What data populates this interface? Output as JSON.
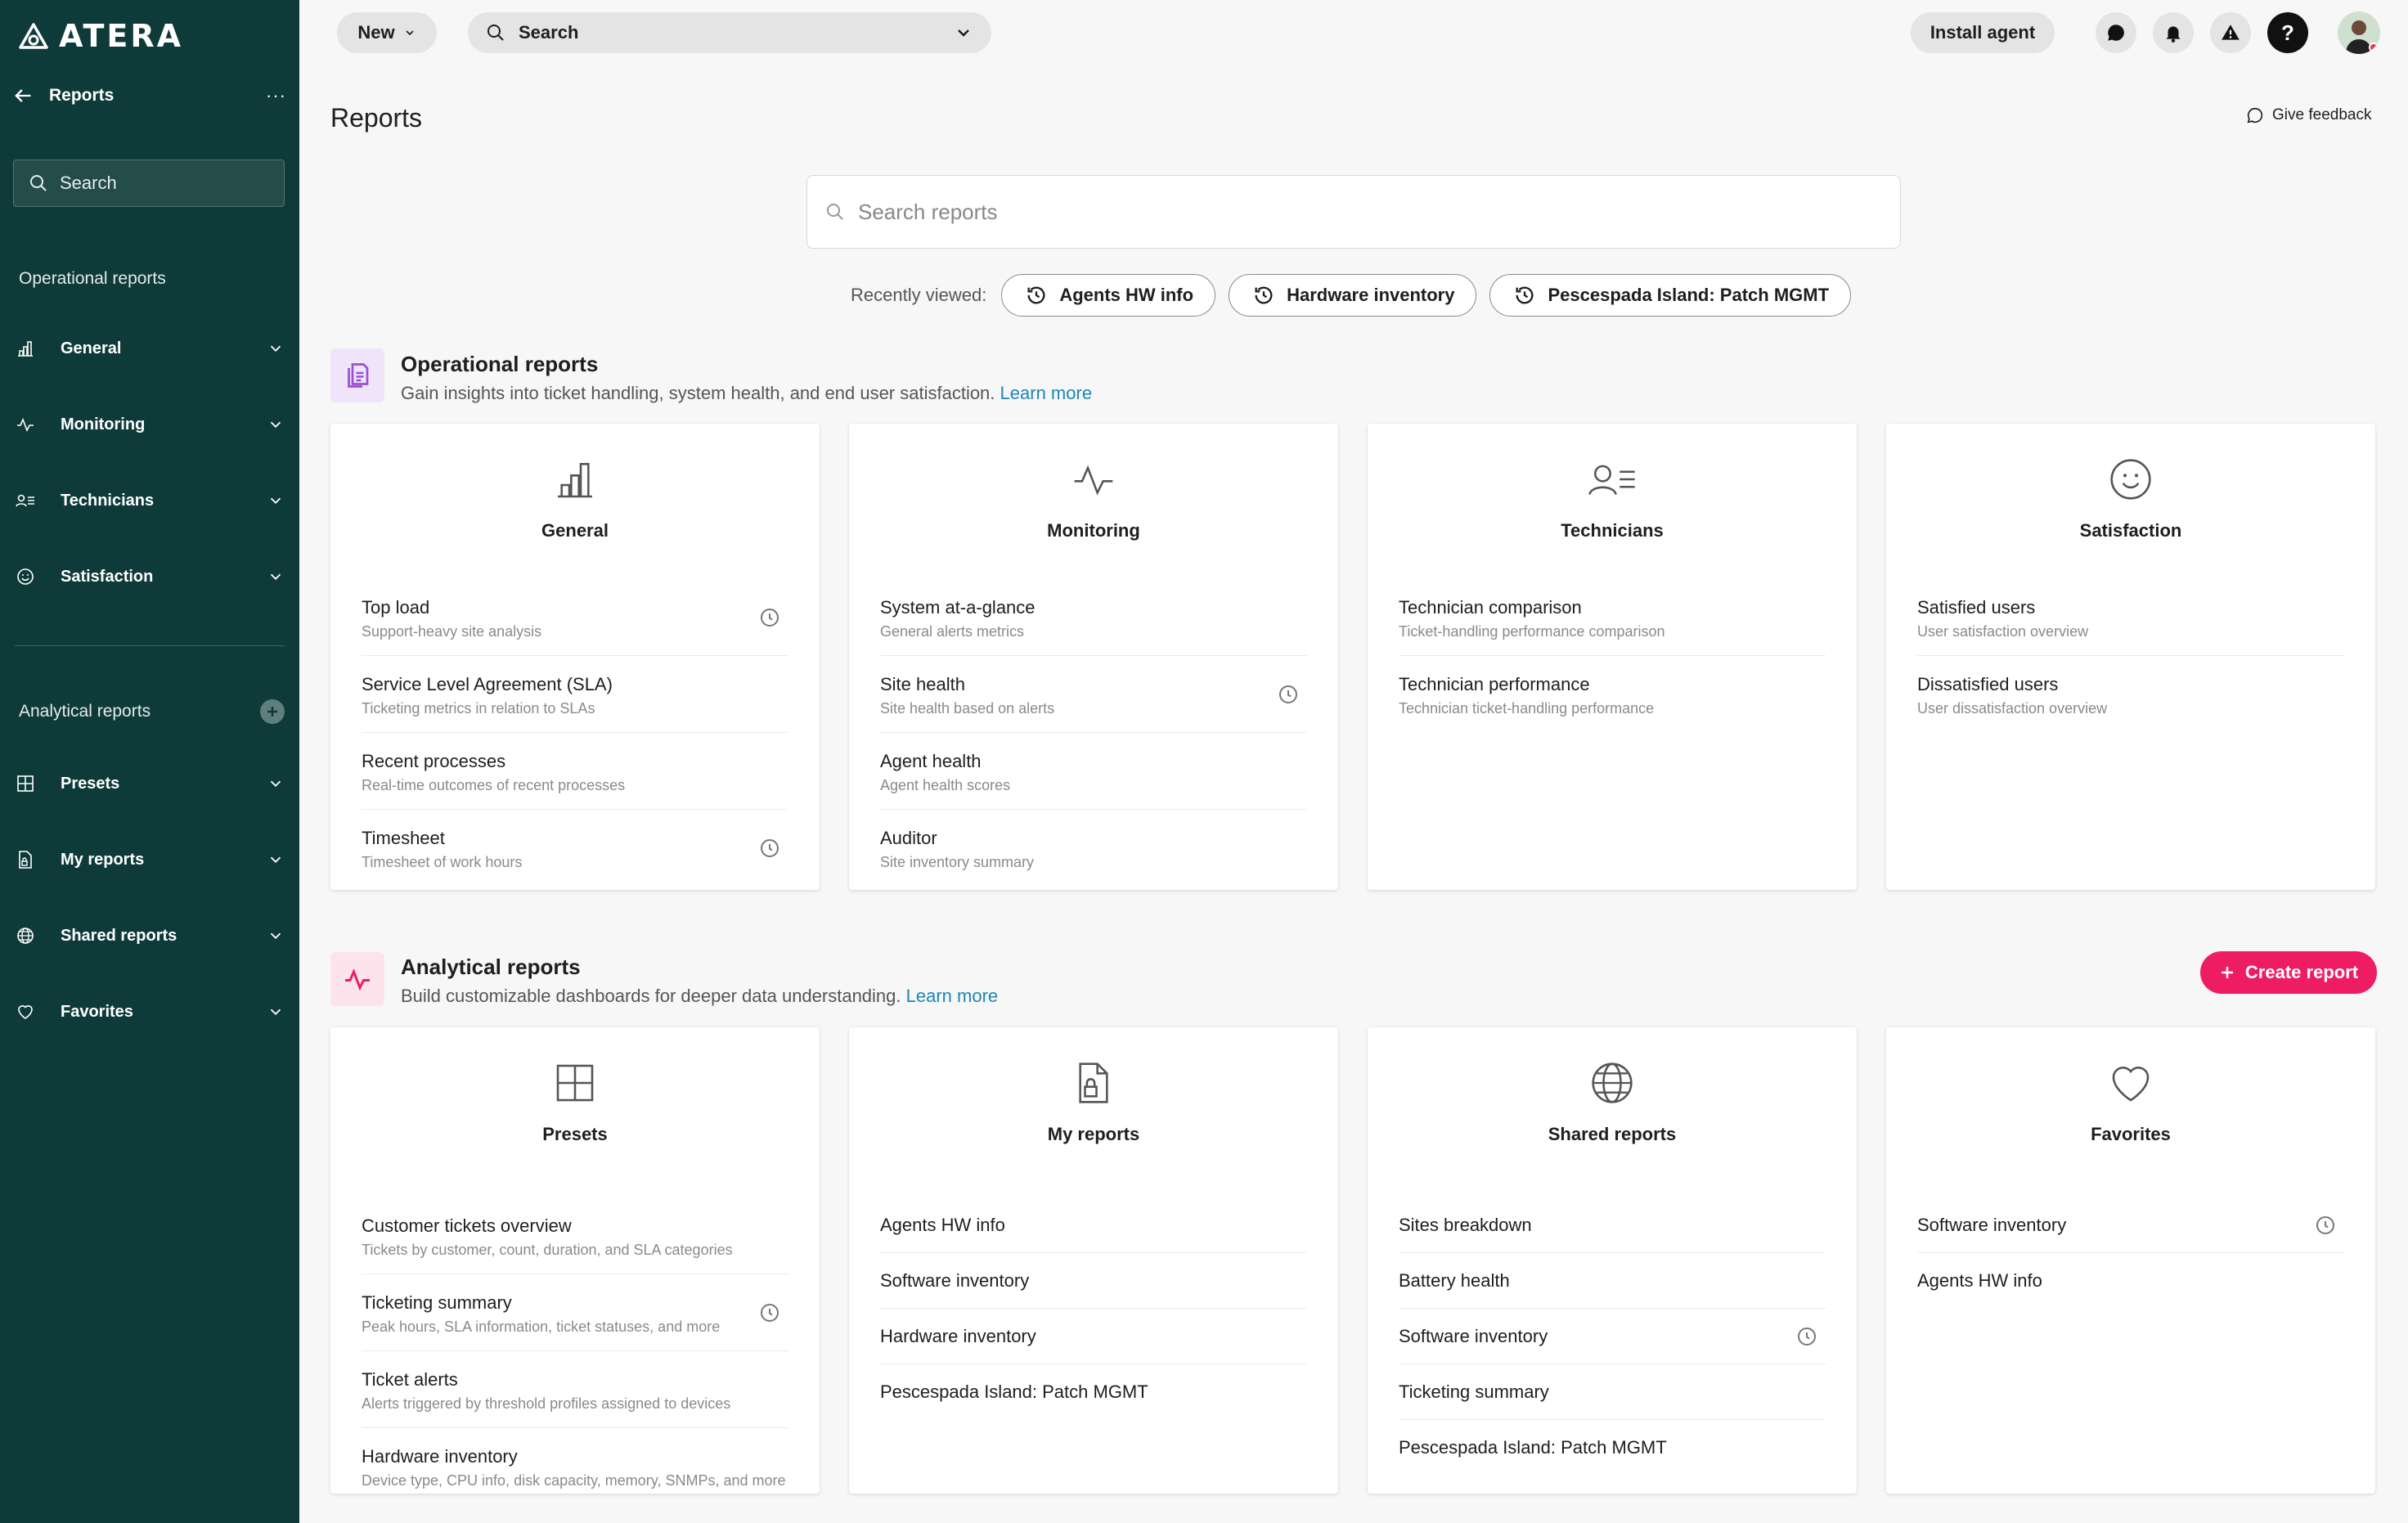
{
  "brand": {
    "logo_text": "ATERA"
  },
  "sidebar": {
    "header_title": "Reports",
    "more_label": "···",
    "search_placeholder": "Search",
    "operational_heading": "Operational reports",
    "operational_items": [
      {
        "label": "General",
        "icon": "bar-chart-icon"
      },
      {
        "label": "Monitoring",
        "icon": "pulse-icon"
      },
      {
        "label": "Technicians",
        "icon": "technician-list-icon"
      },
      {
        "label": "Satisfaction",
        "icon": "smiley-icon"
      }
    ],
    "analytical_heading": "Analytical reports",
    "analytical_items": [
      {
        "label": "Presets",
        "icon": "grid-icon"
      },
      {
        "label": "My reports",
        "icon": "file-lock-icon"
      },
      {
        "label": "Shared reports",
        "icon": "globe-icon"
      },
      {
        "label": "Favorites",
        "icon": "heart-icon"
      }
    ]
  },
  "topbar": {
    "new_label": "New",
    "search_label": "Search",
    "install_label": "Install agent",
    "icons": [
      "chat-icon",
      "bell-icon",
      "alert-icon",
      "help-icon",
      "avatar"
    ]
  },
  "page": {
    "title": "Reports",
    "feedback_label": "Give feedback",
    "search_placeholder": "Search reports",
    "recent_label": "Recently viewed:",
    "recent_chips": [
      "Agents HW info",
      "Hardware inventory",
      "Pescespada Island: Patch MGMT"
    ]
  },
  "operational": {
    "title": "Operational reports",
    "desc": "Gain insights into ticket handling, system health, and end user satisfaction.",
    "learn_more": "Learn more",
    "icon_color": "#9b4fd1",
    "cards": [
      {
        "title": "General",
        "icon": "bar-chart-icon",
        "items": [
          {
            "title": "Top load",
            "sub": "Support-heavy site analysis",
            "recent": true
          },
          {
            "title": "Service Level Agreement (SLA)",
            "sub": "Ticketing metrics in relation to SLAs",
            "recent": false
          },
          {
            "title": "Recent processes",
            "sub": "Real-time outcomes of recent processes",
            "recent": false
          },
          {
            "title": "Timesheet",
            "sub": "Timesheet of work hours",
            "recent": true
          }
        ]
      },
      {
        "title": "Monitoring",
        "icon": "pulse-icon",
        "items": [
          {
            "title": "System at-a-glance",
            "sub": "General alerts metrics",
            "recent": false
          },
          {
            "title": "Site health",
            "sub": "Site health based on alerts",
            "recent": true
          },
          {
            "title": "Agent health",
            "sub": "Agent health scores",
            "recent": false
          },
          {
            "title": "Auditor",
            "sub": "Site inventory summary",
            "recent": false
          }
        ]
      },
      {
        "title": "Technicians",
        "icon": "technician-list-icon",
        "items": [
          {
            "title": "Technician comparison",
            "sub": "Ticket-handling performance comparison",
            "recent": false
          },
          {
            "title": "Technician performance",
            "sub": "Technician ticket-handling performance",
            "recent": false
          }
        ]
      },
      {
        "title": "Satisfaction",
        "icon": "smiley-icon",
        "items": [
          {
            "title": "Satisfied users",
            "sub": "User satisfaction overview",
            "recent": false
          },
          {
            "title": "Dissatisfied users",
            "sub": "User dissatisfaction overview",
            "recent": false
          }
        ]
      }
    ]
  },
  "analytical": {
    "title": "Analytical reports",
    "desc": "Build customizable dashboards for deeper data understanding.",
    "learn_more": "Learn more",
    "create_label": "Create report",
    "icon_color": "#ee1d63",
    "cards": [
      {
        "title": "Presets",
        "icon": "grid-icon",
        "items": [
          {
            "title": "Customer tickets overview",
            "sub": "Tickets by customer, count, duration, and SLA categories",
            "recent": false
          },
          {
            "title": "Ticketing summary",
            "sub": "Peak hours, SLA information, ticket statuses, and more",
            "recent": true
          },
          {
            "title": "Ticket alerts",
            "sub": "Alerts triggered by threshold profiles assigned to devices",
            "recent": false
          },
          {
            "title": "Hardware inventory",
            "sub": "Device type, CPU info, disk capacity, memory, SNMPs, and more",
            "recent": false
          }
        ]
      },
      {
        "title": "My reports",
        "icon": "file-lock-icon",
        "items": [
          {
            "title": "Agents HW info",
            "recent": false
          },
          {
            "title": "Software inventory",
            "recent": false
          },
          {
            "title": "Hardware inventory",
            "recent": false
          },
          {
            "title": "Pescespada Island: Patch MGMT",
            "recent": false
          }
        ]
      },
      {
        "title": "Shared reports",
        "icon": "globe-icon",
        "items": [
          {
            "title": "Sites breakdown",
            "recent": false
          },
          {
            "title": "Battery health",
            "recent": false
          },
          {
            "title": "Software inventory",
            "recent": true
          },
          {
            "title": "Ticketing summary",
            "recent": false
          },
          {
            "title": "Pescespada Island: Patch MGMT",
            "recent": false
          }
        ]
      },
      {
        "title": "Favorites",
        "icon": "heart-icon",
        "items": [
          {
            "title": "Software inventory",
            "recent": true
          },
          {
            "title": "Agents HW info",
            "recent": false
          }
        ]
      }
    ]
  }
}
